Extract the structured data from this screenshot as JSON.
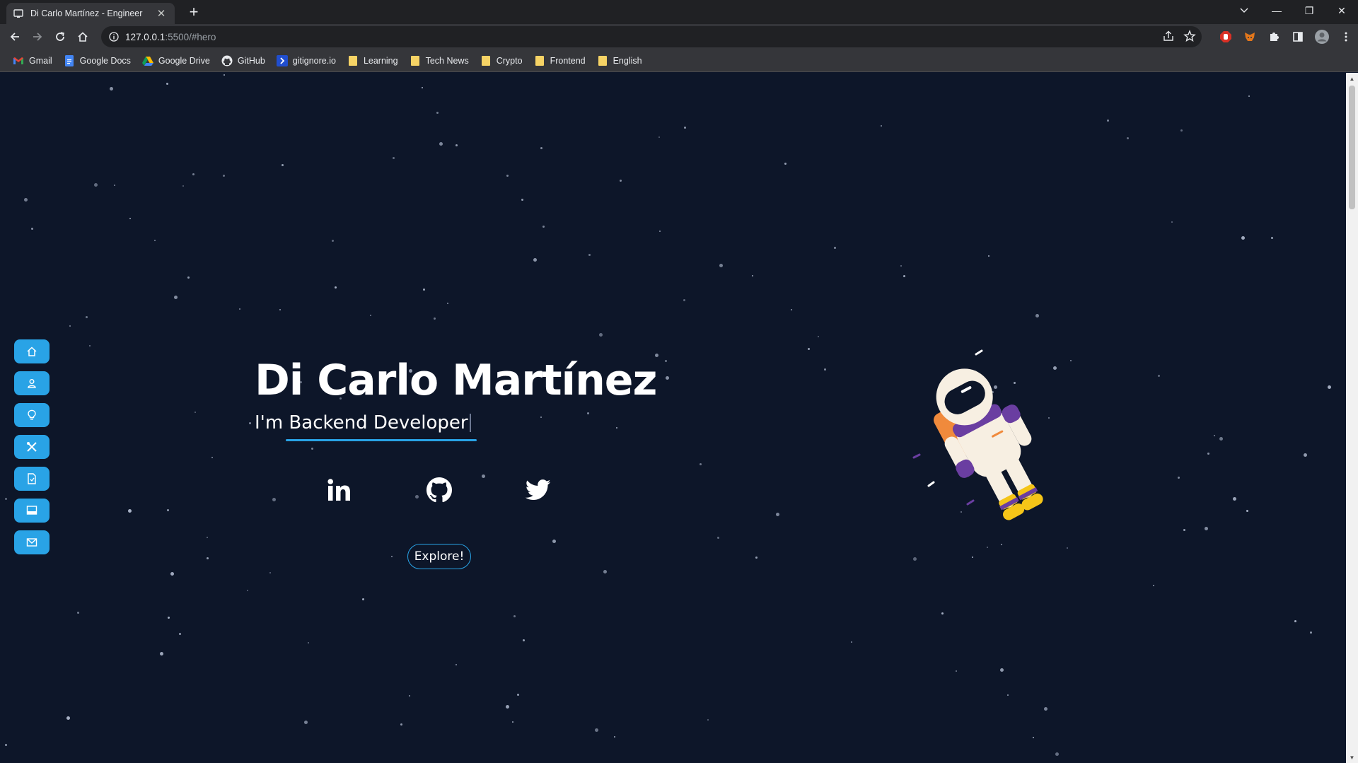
{
  "browser": {
    "tab_title": "Di Carlo Martínez - Engineer",
    "tab_close": "✕",
    "new_tab": "+",
    "url_host": "127.0.0.1",
    "url_rest": ":5500/#hero",
    "window_controls": {
      "minimize": "—",
      "restore": "❐",
      "close": "✕"
    },
    "bookmarks": [
      {
        "label": "Gmail",
        "icon": "gmail-icon"
      },
      {
        "label": "Google Docs",
        "icon": "docs-icon"
      },
      {
        "label": "Google Drive",
        "icon": "drive-icon"
      },
      {
        "label": "GitHub",
        "icon": "github-icon"
      },
      {
        "label": "gitignore.io",
        "icon": "gitignore-icon"
      },
      {
        "label": "Learning",
        "icon": "folder-icon"
      },
      {
        "label": "Tech News",
        "icon": "folder-icon"
      },
      {
        "label": "Crypto",
        "icon": "folder-icon"
      },
      {
        "label": "Frontend",
        "icon": "folder-icon"
      },
      {
        "label": "English",
        "icon": "folder-icon"
      }
    ]
  },
  "page": {
    "background": "#0d1629",
    "accent": "#29a3e6",
    "sidenav": [
      "home-icon",
      "user-icon",
      "lightbulb-icon",
      "tools-icon",
      "document-icon",
      "monitor-icon",
      "mail-icon"
    ],
    "hero": {
      "name": "Di Carlo Martínez",
      "subtitle_prefix": "I'm ",
      "subtitle_role": "Backend Developer",
      "social": [
        "linkedin-icon",
        "github-icon",
        "twitter-icon"
      ],
      "explore_label": "Explore!"
    }
  }
}
